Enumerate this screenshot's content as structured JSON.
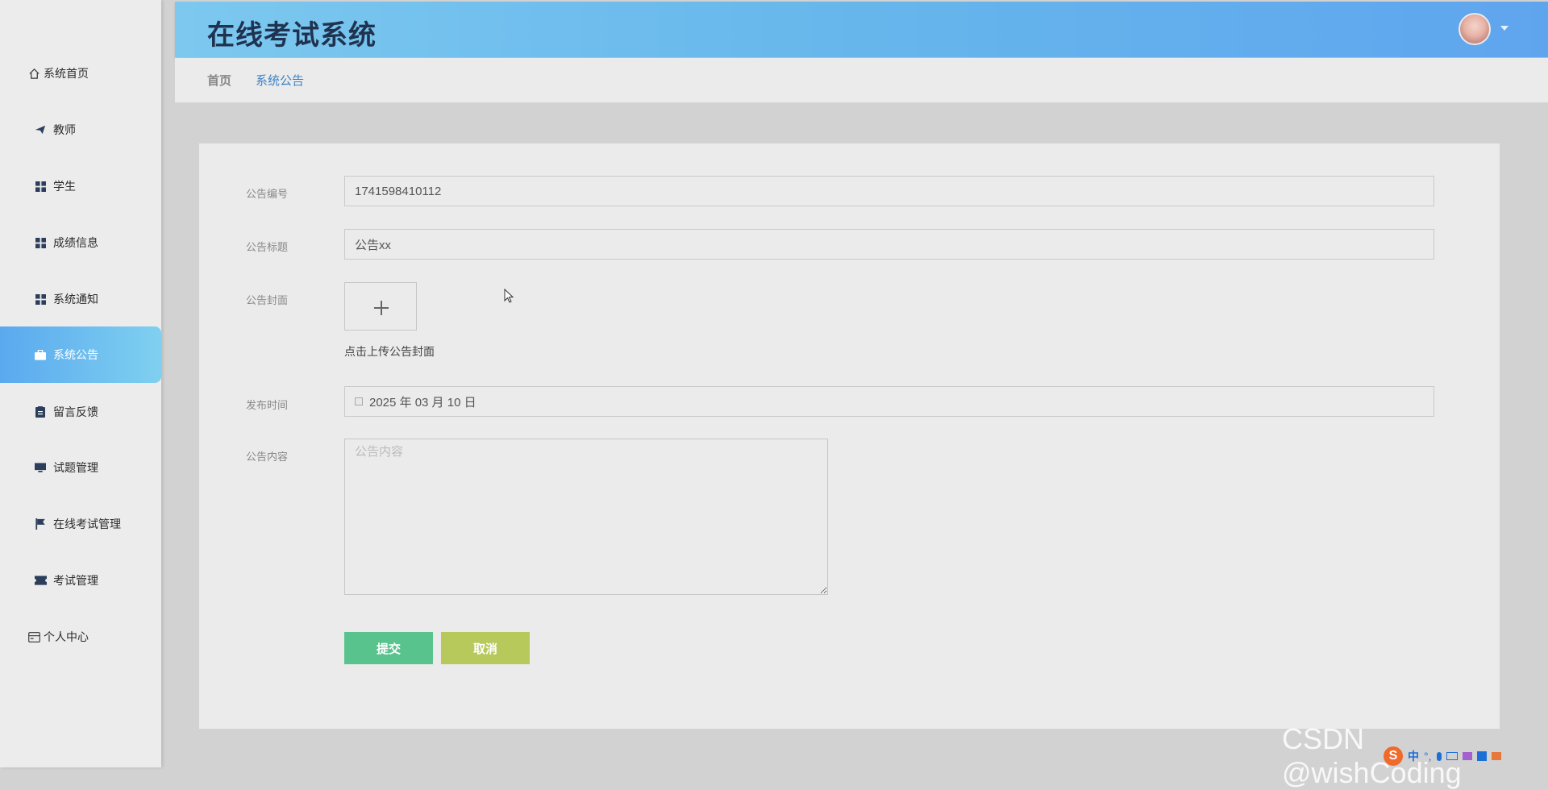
{
  "sidebar": {
    "items": [
      {
        "label": "系统首页",
        "icon": "home-icon"
      },
      {
        "label": "教师",
        "icon": "paper-plane-icon"
      },
      {
        "label": "学生",
        "icon": "grid-icon"
      },
      {
        "label": "成绩信息",
        "icon": "grid-icon"
      },
      {
        "label": "系统通知",
        "icon": "grid-icon"
      },
      {
        "label": "系统公告",
        "icon": "briefcase-icon",
        "active": true
      },
      {
        "label": "留言反馈",
        "icon": "clipboard-icon"
      },
      {
        "label": "试题管理",
        "icon": "monitor-icon"
      },
      {
        "label": "在线考试管理",
        "icon": "flag-icon"
      },
      {
        "label": "考试管理",
        "icon": "ticket-icon"
      },
      {
        "label": "个人中心",
        "icon": "wallet-icon"
      }
    ]
  },
  "header": {
    "title": "在线考试系统",
    "avatar_icon": "user-avatar"
  },
  "breadcrumb": {
    "home": "首页",
    "current": "系统公告"
  },
  "form": {
    "number": {
      "label": "公告编号",
      "value": "1741598410112"
    },
    "title": {
      "label": "公告标题",
      "value": "公告xx"
    },
    "cover": {
      "label": "公告封面",
      "hint": "点击上传公告封面"
    },
    "publish_time": {
      "label": "发布时间",
      "value": "2025 年 03 月 10 日"
    },
    "content": {
      "label": "公告内容",
      "placeholder": "公告内容",
      "value": ""
    },
    "submit_label": "提交",
    "cancel_label": "取消"
  },
  "watermark": "CSDN @wishCoding",
  "tray": {
    "ime_label": "中"
  },
  "colors": {
    "accent": "#5aa9ef",
    "submit": "#59c38e",
    "cancel": "#b7c95b",
    "breadcrumb_current": "#3b82c4"
  }
}
